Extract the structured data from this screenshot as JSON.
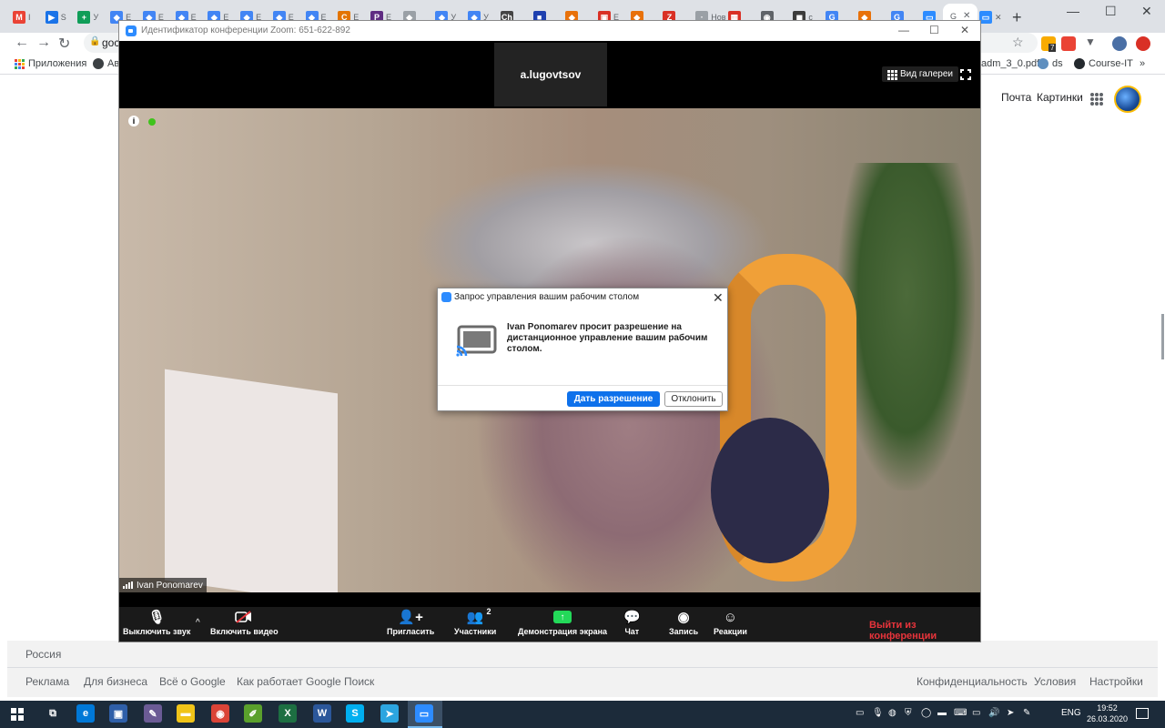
{
  "browser": {
    "tabs": [
      {
        "icon": "gmail-icon",
        "text": "I",
        "color": "#ea4335",
        "glyph": "M"
      },
      {
        "icon": "meet-icon",
        "text": "S",
        "color": "#1a73e8",
        "glyph": "▶"
      },
      {
        "icon": "sheets-icon",
        "text": "У",
        "color": "#0f9d58",
        "glyph": "+"
      },
      {
        "icon": "drive-icon",
        "text": "E",
        "color": "#4285f4",
        "glyph": "◆"
      },
      {
        "icon": "drive-icon",
        "text": "E",
        "color": "#4285f4",
        "glyph": "◆"
      },
      {
        "icon": "drive-icon",
        "text": "E",
        "color": "#4285f4",
        "glyph": "◆"
      },
      {
        "icon": "drive-icon",
        "text": "E",
        "color": "#4285f4",
        "glyph": "◆"
      },
      {
        "icon": "drive-icon",
        "text": "E",
        "color": "#4285f4",
        "glyph": "◆"
      },
      {
        "icon": "drive-icon",
        "text": "E",
        "color": "#4285f4",
        "glyph": "◆"
      },
      {
        "icon": "drive-icon",
        "text": "E",
        "color": "#4285f4",
        "glyph": "◆"
      },
      {
        "icon": "course-icon",
        "text": "E",
        "color": "#e37400",
        "glyph": "C"
      },
      {
        "icon": "doc-icon",
        "text": "E",
        "color": "#5f2c82",
        "glyph": "P"
      },
      {
        "icon": "generic-icon",
        "text": "",
        "color": "#9aa0a6",
        "glyph": "◆"
      },
      {
        "icon": "drive-icon",
        "text": "У",
        "color": "#4285f4",
        "glyph": "◆"
      },
      {
        "icon": "drive-icon",
        "text": "У",
        "color": "#4285f4",
        "glyph": "◆"
      },
      {
        "icon": "ch-icon",
        "text": "",
        "color": "#444444",
        "glyph": "Ch"
      },
      {
        "icon": "flag-icon",
        "text": "",
        "color": "#1e40af",
        "glyph": "■"
      },
      {
        "icon": "fox-icon",
        "text": "",
        "color": "#e8710a",
        "glyph": "◆"
      },
      {
        "icon": "ya-icon",
        "text": "E",
        "color": "#d93025",
        "glyph": "▣"
      },
      {
        "icon": "fox-icon",
        "text": "",
        "color": "#e8710a",
        "glyph": "◆"
      },
      {
        "icon": "z-icon",
        "text": "",
        "color": "#d93025",
        "glyph": "Z"
      },
      {
        "icon": "page-icon",
        "text": "Нов",
        "color": "#9aa0a6",
        "glyph": "·"
      },
      {
        "icon": "grid-icon",
        "text": "",
        "color": "#d93025",
        "glyph": "▦"
      },
      {
        "icon": "globe-icon",
        "text": "",
        "color": "#5f6368",
        "glyph": "◉"
      },
      {
        "icon": "dark-icon",
        "text": "c",
        "color": "#3c3c3c",
        "glyph": "◼"
      },
      {
        "icon": "google-icon",
        "text": "",
        "color": "#4285f4",
        "glyph": "G"
      },
      {
        "icon": "fox-icon",
        "text": "",
        "color": "#e8710a",
        "glyph": "◆"
      },
      {
        "icon": "google-icon",
        "text": "",
        "color": "#4285f4",
        "glyph": "G"
      },
      {
        "icon": "zoom-icon",
        "text": "",
        "color": "#2d8cff",
        "glyph": "▭"
      }
    ],
    "active_tab_text": "G",
    "zoom_tab_close": "✕",
    "new_tab": "+",
    "url": "goc",
    "bookmarks": {
      "apps_label": "Приложения",
      "second_label": "Ав",
      "pdf_label": "adm_3_0.pdf",
      "ds_label": "ds",
      "course_label": "Course-IT",
      "more": "»"
    },
    "ext_badge": "7"
  },
  "google": {
    "mail_link": "Почта",
    "images_link": "Картинки",
    "country": "Россия",
    "footer_left": [
      "Реклама",
      "Для бизнеса",
      "Всё о Google",
      "Как работает Google Поиск"
    ],
    "footer_right": [
      "Конфиденциальность",
      "Условия",
      "Настройки"
    ]
  },
  "zoom": {
    "title": "Идентификатор конференции Zoom: 651-622-892",
    "participant_thumb_name": "a.lugovtsov",
    "gallery_view_label": "Вид галереи",
    "video_name": "Ivan Ponomarev",
    "info_glyph": "i",
    "participants_count": "2",
    "toolbar": {
      "mute_label": "Выключить звук",
      "video_label": "Включить видео",
      "invite_label": "Пригласить",
      "participants_label": "Участники",
      "share_label": "Демонстрация экрана",
      "chat_label": "Чат",
      "record_label": "Запись",
      "reactions_label": "Реакции",
      "leave_label": "Выйти из конференции"
    },
    "colors": {
      "accent": "#2d8cff",
      "leave": "#e8343b",
      "share": "#23d959"
    }
  },
  "dialog": {
    "title": "Запрос управления вашим рабочим столом",
    "message": "Ivan Ponomarev просит разрешение на дистанционное управление вашим рабочим столом.",
    "allow_label": "Дать разрешение",
    "deny_label": "Отклонить",
    "colors": {
      "allow": "#0e71eb"
    }
  },
  "taskbar": {
    "lang": "ENG",
    "time": "19:52",
    "date": "26.03.2020",
    "apps": [
      {
        "name": "task-view-icon",
        "glyph": "⧉",
        "color": "#1c2b3a"
      },
      {
        "name": "edge-icon",
        "glyph": "e",
        "color": "#0078d7"
      },
      {
        "name": "remote-icon",
        "glyph": "▣",
        "color": "#2f5fa8"
      },
      {
        "name": "paint-icon",
        "glyph": "✎",
        "color": "#6b5b95"
      },
      {
        "name": "explorer-icon",
        "glyph": "▬",
        "color": "#f0c419"
      },
      {
        "name": "chrome-icon",
        "glyph": "◉",
        "color": "#db4437"
      },
      {
        "name": "notepad-icon",
        "glyph": "✐",
        "color": "#5aa02c"
      },
      {
        "name": "excel-icon",
        "glyph": "X",
        "color": "#1d6f42"
      },
      {
        "name": "word-icon",
        "glyph": "W",
        "color": "#2b579a"
      },
      {
        "name": "skype-icon",
        "glyph": "S",
        "color": "#00aff0"
      },
      {
        "name": "telegram-icon",
        "glyph": "➤",
        "color": "#2ca5e0"
      },
      {
        "name": "zoom-icon",
        "glyph": "▭",
        "color": "#2d8cff"
      }
    ]
  }
}
